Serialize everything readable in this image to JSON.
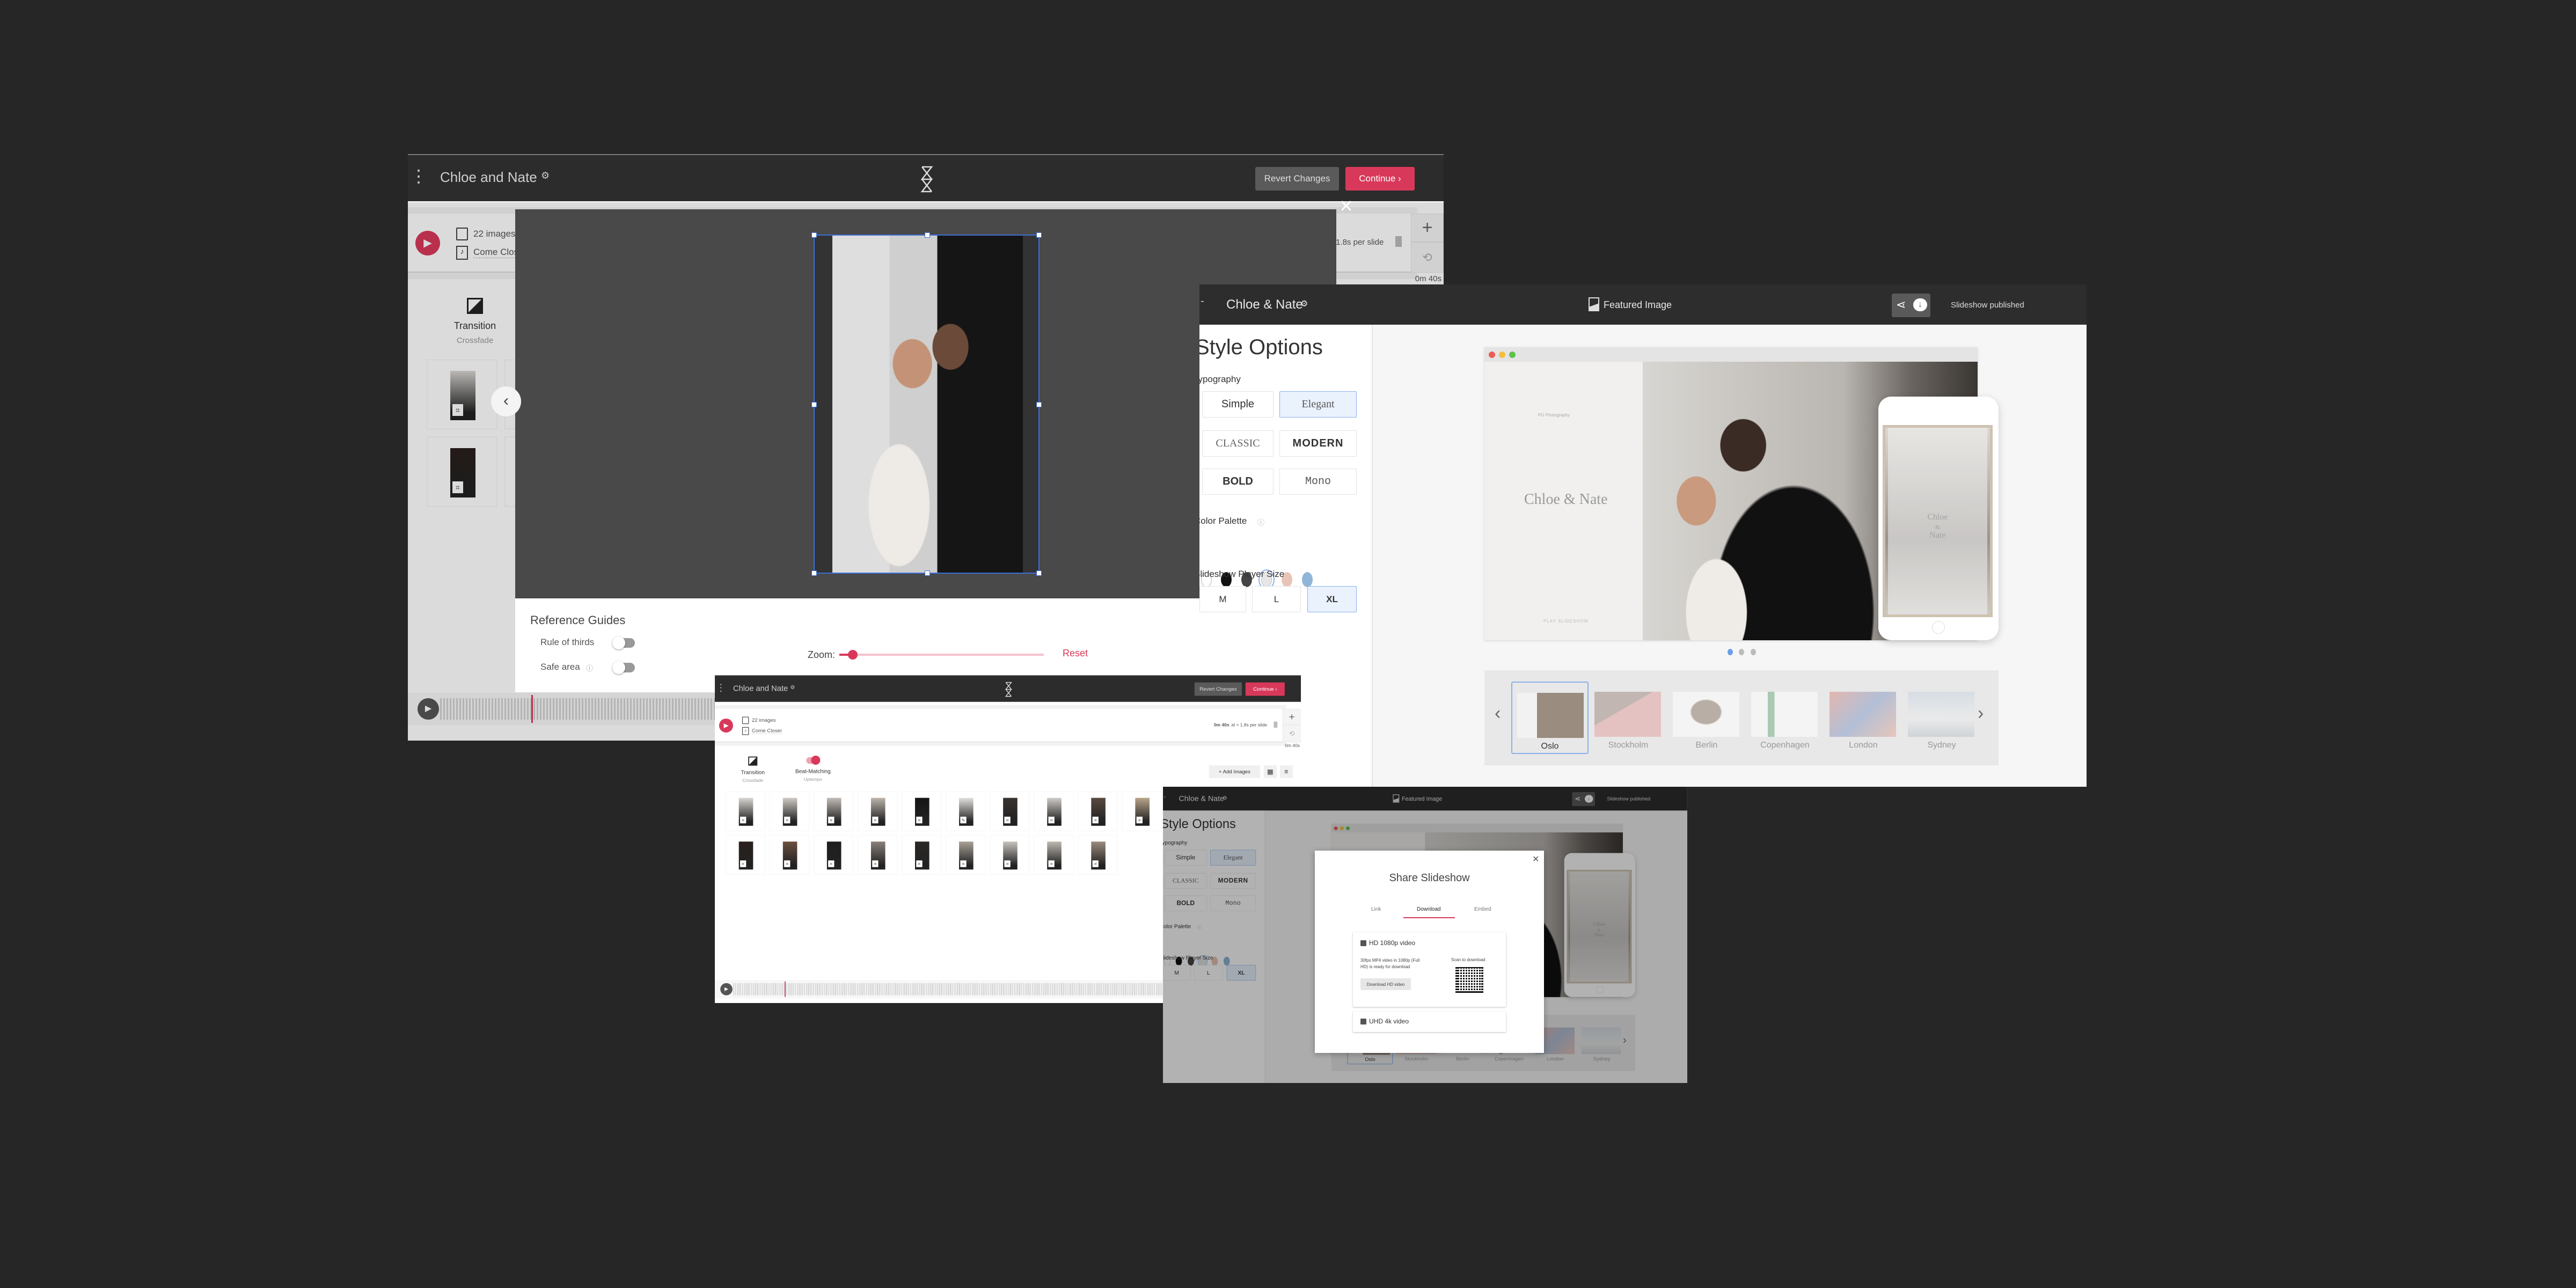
{
  "editor": {
    "title": "Chloe and Nate",
    "revert_label": "Revert Changes",
    "continue_label": "Continue",
    "image_count": "22 images",
    "song": "Come Closer",
    "duration": "0m 40s",
    "per_slide": "at ≈ 1.8s per slide",
    "total_time": "0m 40s",
    "transition_label": "Transition",
    "transition_value": "Crossfade",
    "beat_label": "Beat-Matching",
    "beat_value": "Uptempo",
    "beat_enabled": true,
    "add_images_label": "Add Images",
    "visible_thumbnails": 19
  },
  "crop": {
    "reference_guides": "Reference Guides",
    "rule_of_thirds": "Rule of thirds",
    "safe_area": "Safe area",
    "rule_of_thirds_on": false,
    "safe_area_on": false,
    "zoom_label": "Zoom:",
    "zoom_value": 0.03,
    "reset_label": "Reset"
  },
  "style": {
    "title": "Chloe & Nate",
    "featured_image": "Featured Image",
    "status": "Slideshow published",
    "heading": "Style Options",
    "typography_label": "Typography",
    "fonts": [
      "Simple",
      "Elegant",
      "CLASSIC",
      "MODERN",
      "BOLD",
      "Mono"
    ],
    "selected_font": "Elegant",
    "palette_label": "Color Palette",
    "palette": [
      "#ffffff",
      "#111111",
      "#444444",
      "#e6e6e6",
      "#e8c4b8",
      "#8fb6d6"
    ],
    "selected_palette_index": 3,
    "size_label": "Slideshow Player Size",
    "sizes": [
      "M",
      "L",
      "XL"
    ],
    "selected_size": "XL",
    "preview": {
      "photographer": "PG Photography",
      "names": "Chloe & Nate",
      "play": "PLAY SLIDESHOW",
      "phone_names": [
        "Chloe",
        "&",
        "Nate"
      ],
      "slide_dots": 3,
      "active_dot": 1
    },
    "themes": [
      "Oslo",
      "Stockholm",
      "Berlin",
      "Copenhagen",
      "London",
      "Sydney"
    ],
    "selected_theme": "Oslo"
  },
  "share": {
    "title": "Share Slideshow",
    "tabs": [
      "Link",
      "Download",
      "Embed"
    ],
    "active_tab": "Download",
    "hd_title": "HD 1080p video",
    "hd_description": "30fps MP4 video in 1080p (Full HD) is ready for download",
    "scan_label": "Scan to download",
    "download_button": "Download HD video",
    "uhd_title": "UHD 4k video"
  },
  "colors": {
    "accent": "#d8395a",
    "selected_blue": "#8bb0ea",
    "header": "#2c2c2c"
  }
}
